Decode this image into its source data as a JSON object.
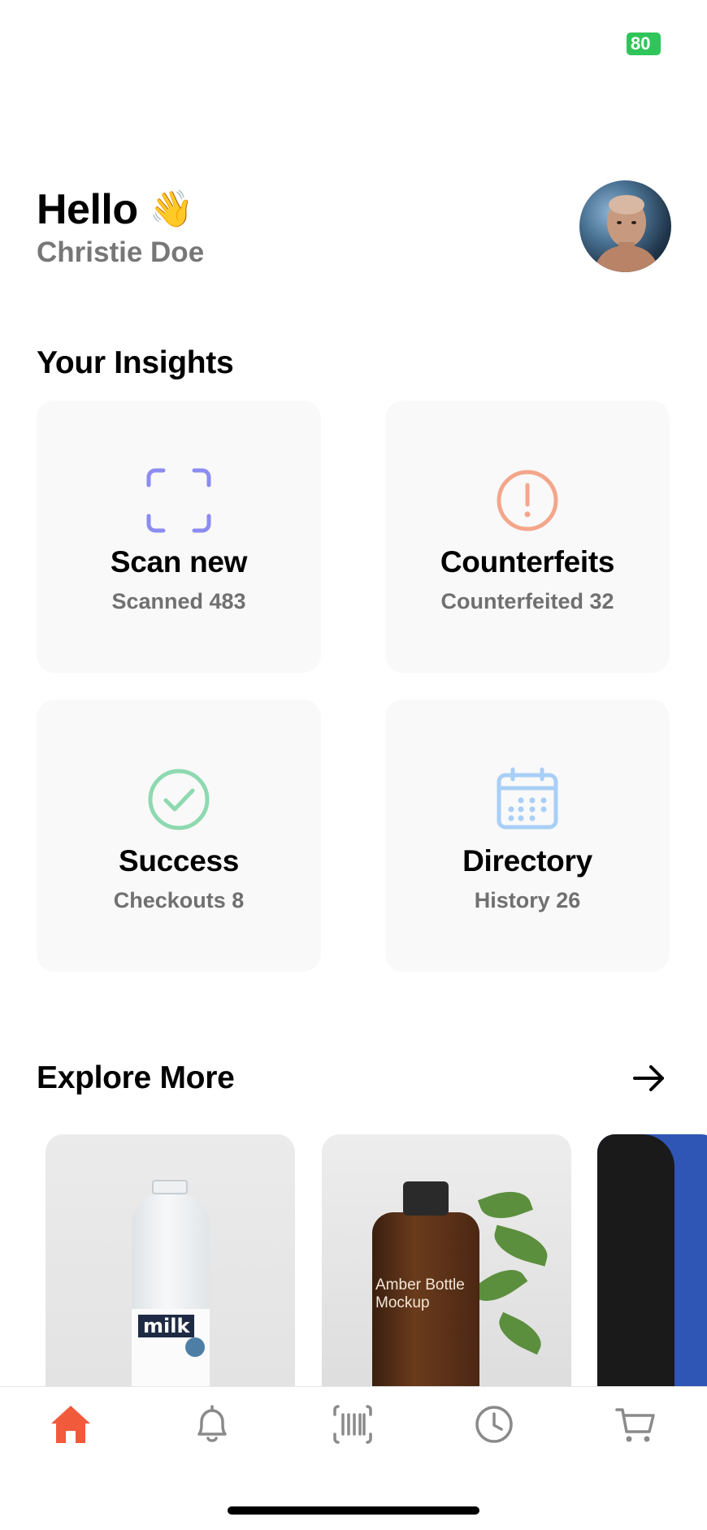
{
  "status_bar": {
    "battery": "80"
  },
  "greeting": {
    "hello": "Hello",
    "wave_emoji": "👋",
    "user_name": "Christie Doe"
  },
  "insights": {
    "title": "Your Insights",
    "cards": [
      {
        "title": "Scan new",
        "subtitle": "Scanned 483",
        "icon": "scan-frame-icon",
        "color": "#8c8cf2"
      },
      {
        "title": "Counterfeits",
        "subtitle": "Counterfeited 32",
        "icon": "alert-circle-icon",
        "color": "#f4a68b"
      },
      {
        "title": "Success",
        "subtitle": "Checkouts 8",
        "icon": "check-circle-icon",
        "color": "#8ed9b0"
      },
      {
        "title": "Directory",
        "subtitle": "History 26",
        "icon": "calendar-icon",
        "color": "#a9cff7"
      }
    ]
  },
  "explore": {
    "title": "Explore More",
    "products": [
      {
        "image": "milk-bottle",
        "label_text": "milk"
      },
      {
        "image": "amber-bottle",
        "label_text": "Amber Bottle Mockup"
      },
      {
        "image": "blue-partial"
      }
    ]
  },
  "bottom_nav": {
    "active": "home",
    "active_color": "#f25a3c",
    "inactive_color": "#8a8a8a",
    "items": [
      {
        "icon": "home-icon"
      },
      {
        "icon": "bell-icon"
      },
      {
        "icon": "barcode-icon"
      },
      {
        "icon": "clock-icon"
      },
      {
        "icon": "cart-icon"
      }
    ]
  }
}
